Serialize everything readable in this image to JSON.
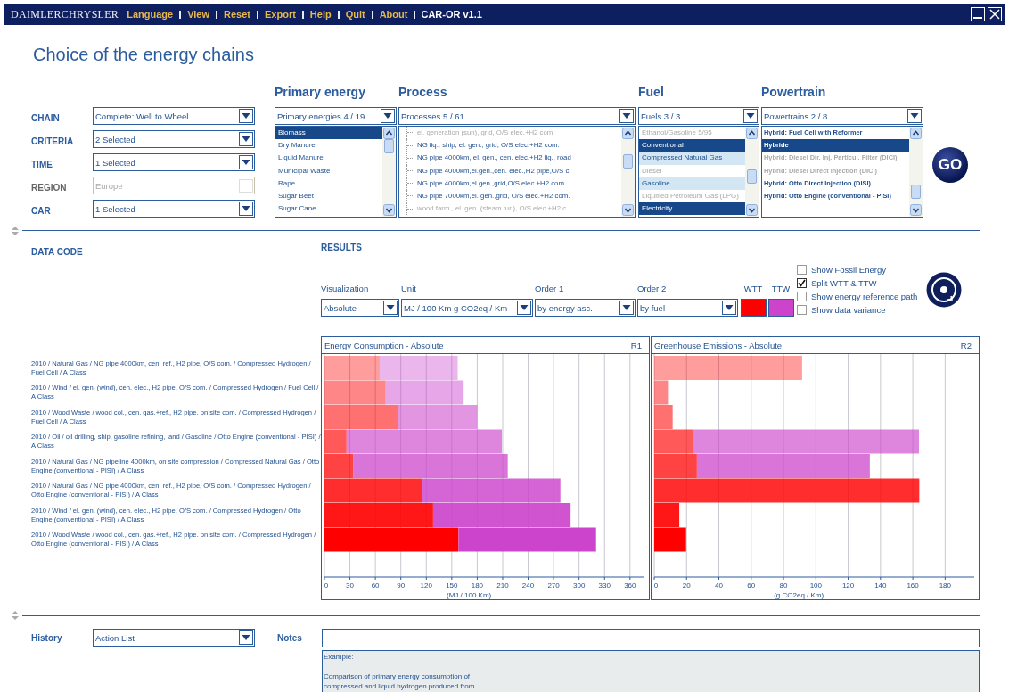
{
  "window": {
    "logo": "DAIMLERCHRYSLER",
    "version": "CAR-OR v1.1"
  },
  "menu": [
    "Language",
    "View",
    "Reset",
    "Export",
    "Help",
    "Quit",
    "About"
  ],
  "title": "Choice of the energy chains",
  "criteria": [
    {
      "label": "CHAIN",
      "value": "Complete: Well to Wheel",
      "disabled": false
    },
    {
      "label": "CRITERIA",
      "value": "2 Selected",
      "disabled": false
    },
    {
      "label": "TIME",
      "value": "1 Selected",
      "disabled": false
    },
    {
      "label": "REGION",
      "value": "Europe",
      "disabled": true
    },
    {
      "label": "CAR",
      "value": "1 Selected",
      "disabled": false
    }
  ],
  "selectors": [
    {
      "heading": "Primary energy",
      "value": "Primary energies 4 / 19",
      "kind": "plain",
      "items": [
        {
          "label": "Biomass",
          "selected": true,
          "disabled": false
        },
        {
          "label": "Dry Manure",
          "selected": false,
          "disabled": false
        },
        {
          "label": "Liquid Manure",
          "selected": false,
          "disabled": false
        },
        {
          "label": "Municipal Waste",
          "selected": false,
          "disabled": false
        },
        {
          "label": "Rape",
          "selected": false,
          "disabled": false
        },
        {
          "label": "Sugar Beet",
          "selected": false,
          "disabled": false
        },
        {
          "label": "Sugar Cane",
          "selected": false,
          "disabled": false
        }
      ]
    },
    {
      "heading": "Process",
      "value": "Processes 5 / 61",
      "kind": "tree",
      "items": [
        {
          "label": "el. generation (sun), grid, O/S elec.+H2 com.",
          "selected": false,
          "disabled": true
        },
        {
          "label": "NG liq., ship, el. gen., grid, O/S elec.+H2 com.",
          "selected": false,
          "disabled": false
        },
        {
          "label": "NG pipe 4000km, el. gen., cen. elec.+H2 liq., road",
          "selected": false,
          "disabled": false
        },
        {
          "label": "NG pipe 4000km,el.gen.,cen. elec.,H2 pipe,O/S c.",
          "selected": false,
          "disabled": false
        },
        {
          "label": "NG pipe 4000km,el.gen.,grid,O/S elec.+H2 com.",
          "selected": false,
          "disabled": false
        },
        {
          "label": "NG pipe 7000km,el. gen.,grid, O/S elec.+H2 com.",
          "selected": false,
          "disabled": false
        },
        {
          "label": "wood farm., el. gen. (steam tur.), O/S elec.+H2 c",
          "selected": false,
          "disabled": true
        }
      ]
    },
    {
      "heading": "Fuel",
      "value": "Fuels 3 / 3",
      "kind": "plain",
      "items": [
        {
          "label": "Ethanol/Gasoline 5/95",
          "selected": false,
          "disabled": true,
          "highlighted": false
        },
        {
          "label": "Conventional",
          "selected": true,
          "disabled": false,
          "highlighted": false
        },
        {
          "label": "Compressed Natural Gas",
          "selected": false,
          "disabled": false,
          "highlighted": true
        },
        {
          "label": "Diesel",
          "selected": false,
          "disabled": true,
          "highlighted": false
        },
        {
          "label": "Gasoline",
          "selected": false,
          "disabled": false,
          "highlighted": true
        },
        {
          "label": "Liquified Petroleum Gas (LPG)",
          "selected": false,
          "disabled": true,
          "highlighted": false
        },
        {
          "label": "Electricity",
          "selected": true,
          "disabled": false,
          "highlighted": false
        }
      ]
    },
    {
      "heading": "Powertrain",
      "value": "Powertrains 2 / 8",
      "kind": "bold",
      "items": [
        {
          "label": "Hybrid: Fuel Cell with Reformer",
          "selected": false,
          "disabled": false
        },
        {
          "label": "Hybride",
          "selected": true,
          "disabled": false
        },
        {
          "label": "Hybrid: Diesel Dir. Inj. Particul. Filter (DICI)",
          "selected": false,
          "disabled": true
        },
        {
          "label": "Hybrid: Diesel Direct Injection (DICI)",
          "selected": false,
          "disabled": true
        },
        {
          "label": "Hybrid: Otto Direct Injection (DISI)",
          "selected": false,
          "disabled": false
        },
        {
          "label": "Hybrid: Otto Engine (conventional - PISI)",
          "selected": false,
          "disabled": false
        }
      ]
    }
  ],
  "go_button": "GO",
  "data_code": {
    "heading": "DATA CODE"
  },
  "results": {
    "heading": "RESULTS",
    "controls": [
      {
        "label": "Visualization",
        "value": "Absolute"
      },
      {
        "label": "Unit",
        "value": "MJ / 100 Km g CO2eq / Km"
      },
      {
        "label": "Order 1",
        "value": "by energy asc."
      },
      {
        "label": "Order 2",
        "value": "by fuel"
      }
    ],
    "options": [
      {
        "label": "Show Fossil Energy",
        "checked": false
      },
      {
        "label": "Split WTT & TTW",
        "checked": true
      },
      {
        "label": "Show energy reference path",
        "checked": false
      },
      {
        "label": "Show data variance",
        "checked": false
      }
    ]
  },
  "charts": [
    {
      "tag": "R1",
      "chart_data": {
        "type": "bar",
        "orientation": "horizontal",
        "stacked": true,
        "title": "Energy Consumption - Absolute",
        "xlabel": "(MJ / 100 Km)",
        "categories": [
          "2010 / Natural Gas / NG pipe 4000km, cen. ref., H2 pipe, O/S com. / Compressed Hydrogen / Fuel Cell / A Class",
          "2010 / Wind / el. gen. (wind), cen. elec., H2 pipe, O/S com. / Compressed Hydrogen / Fuel Cell / A Class",
          "2010 / Wood Waste / wood col., cen. gas.+ref., H2 pipe. on site com. / Compressed Hydrogen / Fuel Cell / A Class",
          "2010 / Oil / oil drilling, ship, gasoline refining, land / Gasoline / Otto Engine (conventional - PISI) / A Class",
          "2010 / Natural Gas / NG pipeline 4000km, on site compression / Compressed Natural Gas / Otto Engine (conventional - PISI) / A Class",
          "2010 / Natural Gas / NG pipe 4000km, cen. ref., H2 pipe, O/S com. / Compressed Hydrogen / Otto Engine (conventional - PISI) / A Class",
          "2010 / Wind / el. gen. (wind), cen. elec., H2 pipe, O/S com. / Compressed Hydrogen / Otto Engine (conventional - PISI) / A Class",
          "2010 / Wood Waste / wood col., cen. gas.+ref., H2 pipe. on site com. / Compressed Hydrogen / Otto Engine (conventional - PISI) / A Class"
        ],
        "grid": true,
        "xlim": [
          0,
          377
        ],
        "xticks": [
          0,
          30,
          60,
          90,
          120,
          150,
          180,
          210,
          240,
          270,
          300,
          330,
          360
        ],
        "series": [
          {
            "name": "WTT",
            "color": "#ff0000",
            "values": [
              65,
              72,
              87,
              26,
              34,
              115,
              128,
              158
            ]
          },
          {
            "name": "TTW",
            "color": "#cc44cc",
            "values": [
              92,
              92,
              93,
              183,
              182,
              163,
              162,
              162
            ]
          }
        ]
      }
    },
    {
      "tag": "R2",
      "chart_data": {
        "type": "bar",
        "orientation": "horizontal",
        "stacked": true,
        "title": "Greenhouse Emissions - Absolute",
        "xlabel": "(g CO2eq / Km)",
        "grid": true,
        "xlim": [
          0,
          198
        ],
        "xticks": [
          0,
          20,
          40,
          60,
          80,
          100,
          120,
          140,
          160,
          180
        ],
        "series": [
          {
            "color": "#ff0000",
            "values": [
              91.5,
              8.5,
              11.4,
              23.8,
              26.4,
              164,
              15.5,
              19.7
            ]
          },
          {
            "color": "#cc44cc",
            "values": [
              0,
              0,
              0,
              140,
              107,
              0,
              0,
              0
            ]
          }
        ]
      }
    }
  ],
  "history": {
    "label": "History",
    "value": "Action List"
  },
  "notes": {
    "label": "Notes",
    "example": "Example:\n\nComparison of primary energy consumption of\ncompressed and liquid hydrogen produced from"
  }
}
